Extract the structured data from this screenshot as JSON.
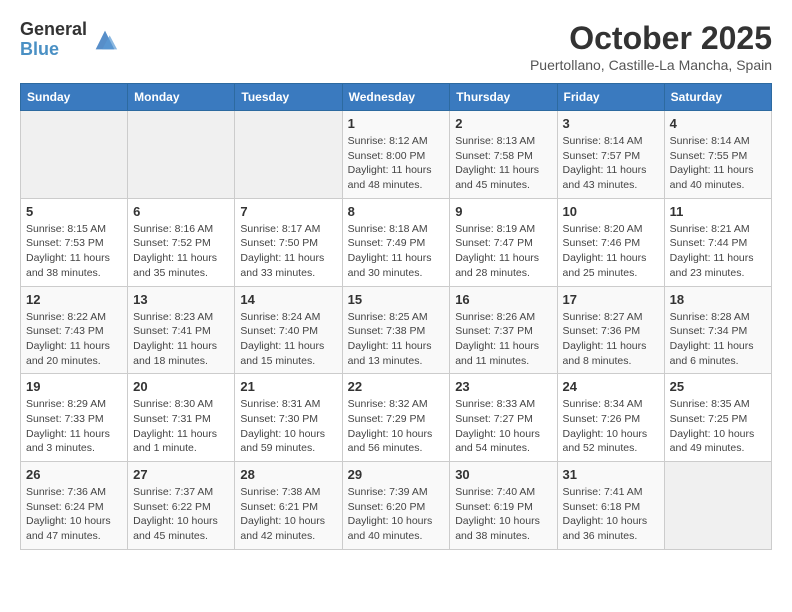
{
  "header": {
    "logo_general": "General",
    "logo_blue": "Blue",
    "title": "October 2025",
    "subtitle": "Puertollano, Castille-La Mancha, Spain"
  },
  "days_of_week": [
    "Sunday",
    "Monday",
    "Tuesday",
    "Wednesday",
    "Thursday",
    "Friday",
    "Saturday"
  ],
  "weeks": [
    [
      {
        "day": "",
        "info": ""
      },
      {
        "day": "",
        "info": ""
      },
      {
        "day": "",
        "info": ""
      },
      {
        "day": "1",
        "info": "Sunrise: 8:12 AM\nSunset: 8:00 PM\nDaylight: 11 hours and 48 minutes."
      },
      {
        "day": "2",
        "info": "Sunrise: 8:13 AM\nSunset: 7:58 PM\nDaylight: 11 hours and 45 minutes."
      },
      {
        "day": "3",
        "info": "Sunrise: 8:14 AM\nSunset: 7:57 PM\nDaylight: 11 hours and 43 minutes."
      },
      {
        "day": "4",
        "info": "Sunrise: 8:14 AM\nSunset: 7:55 PM\nDaylight: 11 hours and 40 minutes."
      }
    ],
    [
      {
        "day": "5",
        "info": "Sunrise: 8:15 AM\nSunset: 7:53 PM\nDaylight: 11 hours and 38 minutes."
      },
      {
        "day": "6",
        "info": "Sunrise: 8:16 AM\nSunset: 7:52 PM\nDaylight: 11 hours and 35 minutes."
      },
      {
        "day": "7",
        "info": "Sunrise: 8:17 AM\nSunset: 7:50 PM\nDaylight: 11 hours and 33 minutes."
      },
      {
        "day": "8",
        "info": "Sunrise: 8:18 AM\nSunset: 7:49 PM\nDaylight: 11 hours and 30 minutes."
      },
      {
        "day": "9",
        "info": "Sunrise: 8:19 AM\nSunset: 7:47 PM\nDaylight: 11 hours and 28 minutes."
      },
      {
        "day": "10",
        "info": "Sunrise: 8:20 AM\nSunset: 7:46 PM\nDaylight: 11 hours and 25 minutes."
      },
      {
        "day": "11",
        "info": "Sunrise: 8:21 AM\nSunset: 7:44 PM\nDaylight: 11 hours and 23 minutes."
      }
    ],
    [
      {
        "day": "12",
        "info": "Sunrise: 8:22 AM\nSunset: 7:43 PM\nDaylight: 11 hours and 20 minutes."
      },
      {
        "day": "13",
        "info": "Sunrise: 8:23 AM\nSunset: 7:41 PM\nDaylight: 11 hours and 18 minutes."
      },
      {
        "day": "14",
        "info": "Sunrise: 8:24 AM\nSunset: 7:40 PM\nDaylight: 11 hours and 15 minutes."
      },
      {
        "day": "15",
        "info": "Sunrise: 8:25 AM\nSunset: 7:38 PM\nDaylight: 11 hours and 13 minutes."
      },
      {
        "day": "16",
        "info": "Sunrise: 8:26 AM\nSunset: 7:37 PM\nDaylight: 11 hours and 11 minutes."
      },
      {
        "day": "17",
        "info": "Sunrise: 8:27 AM\nSunset: 7:36 PM\nDaylight: 11 hours and 8 minutes."
      },
      {
        "day": "18",
        "info": "Sunrise: 8:28 AM\nSunset: 7:34 PM\nDaylight: 11 hours and 6 minutes."
      }
    ],
    [
      {
        "day": "19",
        "info": "Sunrise: 8:29 AM\nSunset: 7:33 PM\nDaylight: 11 hours and 3 minutes."
      },
      {
        "day": "20",
        "info": "Sunrise: 8:30 AM\nSunset: 7:31 PM\nDaylight: 11 hours and 1 minute."
      },
      {
        "day": "21",
        "info": "Sunrise: 8:31 AM\nSunset: 7:30 PM\nDaylight: 10 hours and 59 minutes."
      },
      {
        "day": "22",
        "info": "Sunrise: 8:32 AM\nSunset: 7:29 PM\nDaylight: 10 hours and 56 minutes."
      },
      {
        "day": "23",
        "info": "Sunrise: 8:33 AM\nSunset: 7:27 PM\nDaylight: 10 hours and 54 minutes."
      },
      {
        "day": "24",
        "info": "Sunrise: 8:34 AM\nSunset: 7:26 PM\nDaylight: 10 hours and 52 minutes."
      },
      {
        "day": "25",
        "info": "Sunrise: 8:35 AM\nSunset: 7:25 PM\nDaylight: 10 hours and 49 minutes."
      }
    ],
    [
      {
        "day": "26",
        "info": "Sunrise: 7:36 AM\nSunset: 6:24 PM\nDaylight: 10 hours and 47 minutes."
      },
      {
        "day": "27",
        "info": "Sunrise: 7:37 AM\nSunset: 6:22 PM\nDaylight: 10 hours and 45 minutes."
      },
      {
        "day": "28",
        "info": "Sunrise: 7:38 AM\nSunset: 6:21 PM\nDaylight: 10 hours and 42 minutes."
      },
      {
        "day": "29",
        "info": "Sunrise: 7:39 AM\nSunset: 6:20 PM\nDaylight: 10 hours and 40 minutes."
      },
      {
        "day": "30",
        "info": "Sunrise: 7:40 AM\nSunset: 6:19 PM\nDaylight: 10 hours and 38 minutes."
      },
      {
        "day": "31",
        "info": "Sunrise: 7:41 AM\nSunset: 6:18 PM\nDaylight: 10 hours and 36 minutes."
      },
      {
        "day": "",
        "info": ""
      }
    ]
  ]
}
